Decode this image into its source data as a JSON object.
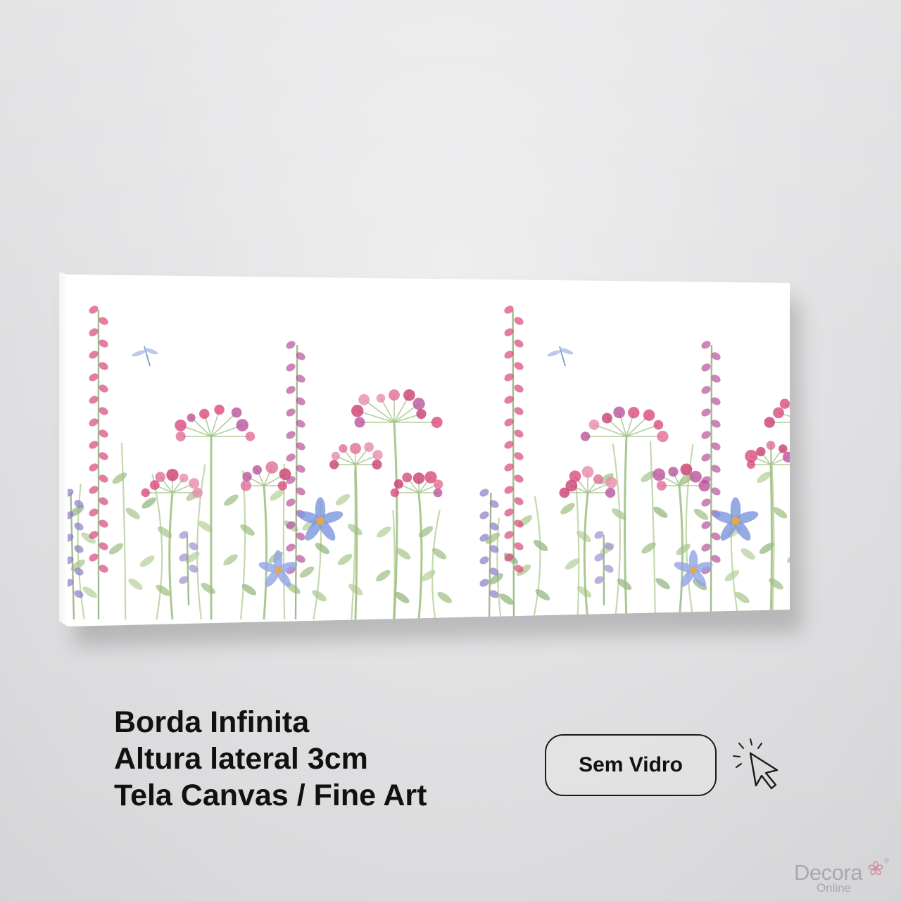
{
  "features": [
    "Borda Infinita",
    "Altura lateral 3cm",
    "Tela Canvas / Fine Art"
  ],
  "option_button": {
    "label": "Sem Vidro"
  },
  "brand": {
    "main": "Decora",
    "sub": "Online",
    "reg": "®"
  },
  "icons": {
    "cursor": "click-cursor-icon",
    "logo": "flower-logo-icon"
  },
  "colors": {
    "text": "#111111",
    "wall": "#e4e4e6",
    "brand_gray": "#a9a9ab"
  }
}
